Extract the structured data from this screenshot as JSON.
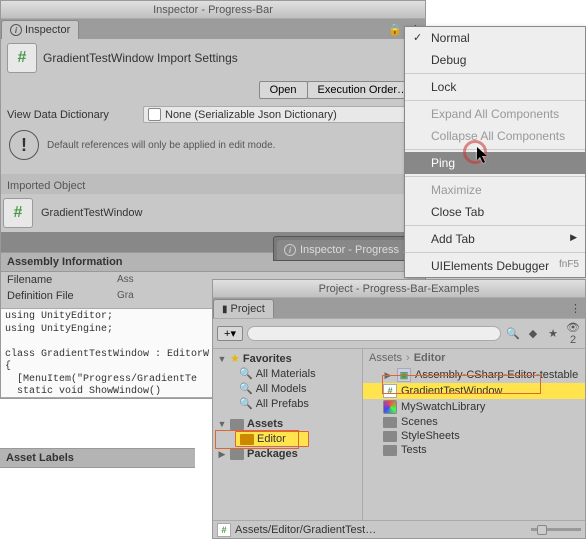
{
  "inspector": {
    "win_title": "Inspector - Progress-Bar",
    "tab_label": "Inspector",
    "title": "GradientTestWindow Import Settings",
    "open_btn": "Open",
    "exec_btn": "Execution Order…",
    "view_dd_label": "View Data Dictionary",
    "view_dd_value": "None (Serializable Json Dictionary)",
    "info": "Default references will only be applied in edit mode.",
    "imported_label": "Imported Object",
    "imported_item": "GradientTestWindow",
    "assembly_hdr": "Assembly Information",
    "filename_label": "Filename",
    "filename_val": "Ass",
    "deffile_label": "Definition File",
    "deffile_val": "Gra",
    "code": "using UnityEditor;\nusing UnityEngine;\n\nclass GradientTestWindow : EditorW\n{\n  [MenuItem(\"Progress/GradientTe\n  static void ShowWindow()",
    "asset_labels": "Asset Labels"
  },
  "ctx": {
    "normal": "Normal",
    "debug": "Debug",
    "lock": "Lock",
    "expand": "Expand All Components",
    "collapse": "Collapse All Components",
    "ping": "Ping",
    "maximize": "Maximize",
    "close": "Close Tab",
    "addtab": "Add Tab",
    "uidebug": "UIElements Debugger",
    "uidebug_kbd": "fnF5"
  },
  "dark_tab": "Inspector - Progress  …",
  "project": {
    "win_title": "Project - Progress-Bar-Examples",
    "tab_label": "Project",
    "plus": "+",
    "favorites": "Favorites",
    "fav": [
      "All Materials",
      "All Models",
      "All Prefabs"
    ],
    "assets": "Assets",
    "editor": "Editor",
    "packages": "Packages",
    "crumb_root": "Assets",
    "crumb_leaf": "Editor",
    "items": [
      {
        "name": "Assembly-CSharp-Editor-testable",
        "type": "asm"
      },
      {
        "name": "GradientTestWindow",
        "type": "script"
      },
      {
        "name": "MySwatchLibrary",
        "type": "swatch"
      },
      {
        "name": "Scenes",
        "type": "folder"
      },
      {
        "name": "StyleSheets",
        "type": "folder"
      },
      {
        "name": "Tests",
        "type": "folder"
      }
    ],
    "footer": "Assets/Editor/GradientTest…"
  }
}
